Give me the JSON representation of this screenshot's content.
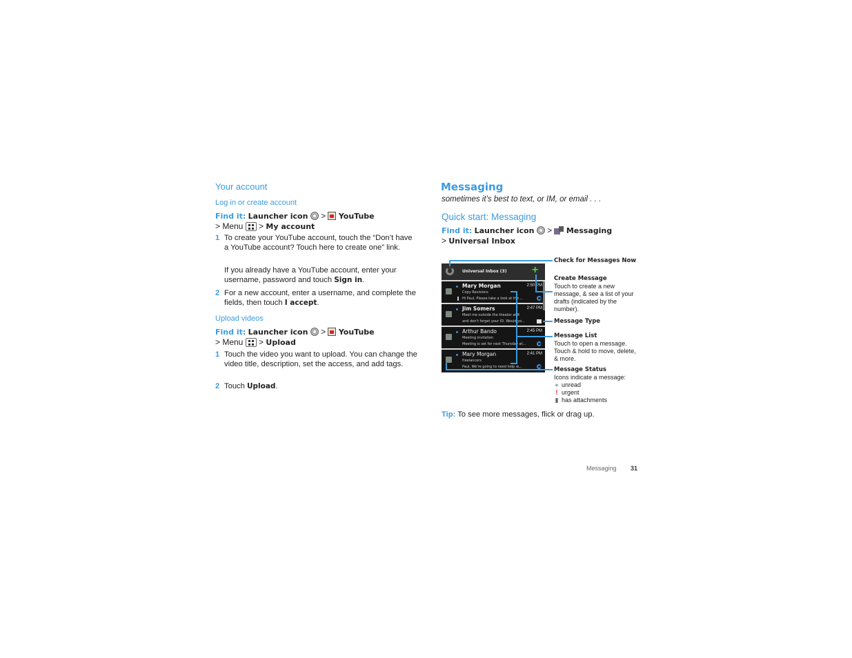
{
  "left": {
    "section_title": "Your account",
    "login": {
      "subtitle": "Log in or create account",
      "findit_label": "Find it:",
      "launcher": "Launcher icon",
      "gt": ">",
      "app": "YouTube",
      "menu_prefix": "> Menu",
      "menu_target": "My account",
      "steps": [
        {
          "num": "1",
          "text": "To create your YouTube account, touch the “Don’t have a YouTube account? Touch here to create one” link."
        },
        {
          "num": "",
          "text_pre": "If you already have a YouTube account, enter your username, password and touch ",
          "text_bold": "Sign in",
          "text_post": "."
        },
        {
          "num": "2",
          "text_pre": "For a new account, enter a username, and complete the fields, then touch ",
          "text_bold": "I accept",
          "text_post": "."
        }
      ]
    },
    "upload": {
      "subtitle": "Upload videos",
      "findit_label": "Find it:",
      "launcher": "Launcher icon",
      "gt": ">",
      "app": "YouTube",
      "menu_prefix": "> Menu",
      "menu_target": "Upload",
      "steps": [
        {
          "num": "1",
          "text": "Touch the video you want to upload. You can change the video title, description, set the access, and add tags."
        },
        {
          "num": "2",
          "text_pre": "Touch ",
          "text_bold": "Upload",
          "text_post": "."
        }
      ]
    }
  },
  "right": {
    "title": "Messaging",
    "tagline": "sometimes it’s best to text, or IM, or email . . .",
    "quick_start": "Quick start: Messaging",
    "findit_label": "Find it:",
    "launcher": "Launcher icon",
    "gt": ">",
    "app": "Messaging",
    "target_prefix": ">",
    "target": "Universal Inbox",
    "phone": {
      "header_title": "Universal Inbox (3)",
      "messages": [
        {
          "name": "Mary Morgan",
          "time": "2:50 PM",
          "subject": "Copy Revisions",
          "preview": "Hi Paul, Please take a look at the ...",
          "unread": true,
          "attachment": true,
          "type": "sync"
        },
        {
          "name": "Jim Somers",
          "time": "2:47 PM",
          "subject": "Meet me outside the theater at 8",
          "preview": "and don't forget your ID. Would yo...",
          "unread": true,
          "attachment": false,
          "type": "email"
        },
        {
          "name": "Arthur Bando",
          "time": "2:45 PM",
          "subject": "Meeting invitation",
          "preview": "Meeting is set for next Thursday at...",
          "unread": false,
          "attachment": false,
          "type": "sync"
        },
        {
          "name": "Mary Morgan",
          "time": "2:41 PM",
          "subject": "freelancers",
          "preview": "Paul, We're going to need help w...",
          "unread": false,
          "attachment": false,
          "type": "sync"
        }
      ]
    },
    "callouts": {
      "check": {
        "title": "Check for Messages Now"
      },
      "create": {
        "title": "Create Message",
        "desc": "Touch to create a new message, & see a list of your drafts (indicated by the number)."
      },
      "type": {
        "title": "Message Type"
      },
      "list": {
        "title": "Message List",
        "desc": "Touch to open a message. Touch & hold to move, delete, & more."
      },
      "status": {
        "title": "Message Status",
        "desc": "Icons indicate a message:",
        "items": [
          {
            "icon": "unread-dot-icon",
            "label": "unread"
          },
          {
            "icon": "urgent-exclamation-icon",
            "label": "urgent"
          },
          {
            "icon": "attachment-icon",
            "label": "has attachments"
          }
        ]
      }
    },
    "tip_label": "Tip:",
    "tip_text": "To see more messages, flick or drag up."
  },
  "footer": {
    "section": "Messaging",
    "page": "31"
  }
}
